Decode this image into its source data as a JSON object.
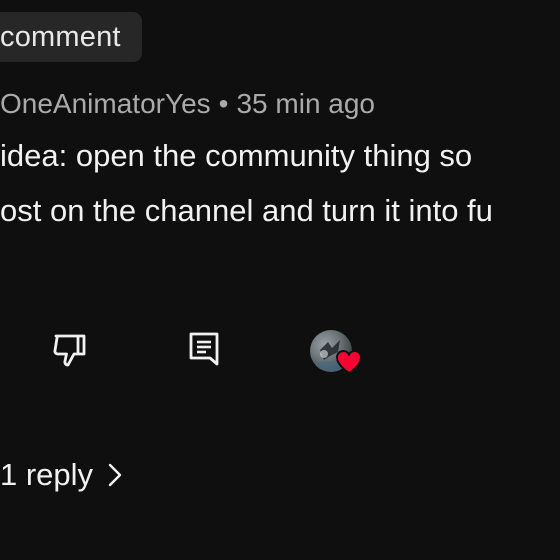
{
  "header": {
    "chip_label": "comment"
  },
  "comment": {
    "author": "OneAnimatorYes",
    "separator": "•",
    "time_ago": "35 min ago",
    "text_line1": "idea: open the community thing so",
    "text_line2": "ost on the channel and turn it into fu"
  },
  "actions": {
    "dislike_icon": "thumbs-down-icon",
    "reply_icon": "comment-icon",
    "creator_heart_icon": "heart-icon",
    "heart_color": "#ff0033"
  },
  "replies": {
    "label": "1 reply",
    "chevron_icon": "chevron-right-icon"
  }
}
